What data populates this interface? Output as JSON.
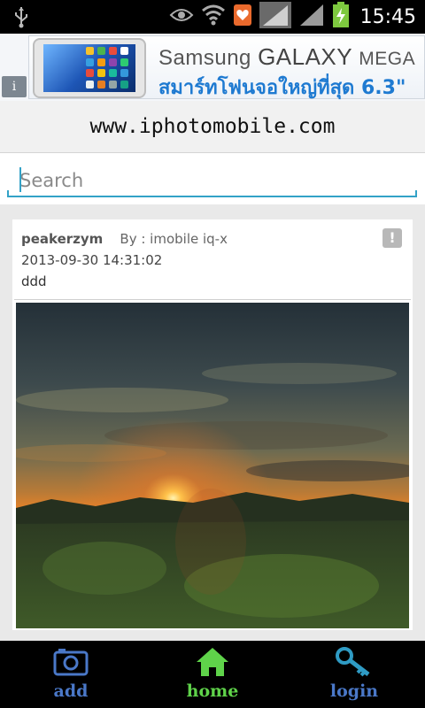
{
  "status_bar": {
    "time": "15:45",
    "icons": [
      "usb-icon",
      "eye-icon",
      "wifi-icon",
      "notification-icon",
      "signal-icon",
      "signal-icon-2",
      "battery-charging-icon"
    ]
  },
  "ad": {
    "brand": "Samsung",
    "model_big": "GALAXY",
    "model_small": "MEGA",
    "tagline": "สมาร์ทโฟนจอใหญ่ที่สุด 6.3\"",
    "info_icon": "i"
  },
  "site": {
    "url": "www.iphotomobile.com"
  },
  "search": {
    "placeholder": "Search",
    "value": ""
  },
  "post": {
    "author": "peakerzym",
    "by": "By : imobile iq-x",
    "date": "2013-09-30 14:31:02",
    "text": "ddd",
    "report_label": "!"
  },
  "bottom_nav": {
    "add": "add",
    "home": "home",
    "login": "login"
  },
  "colors": {
    "accent": "#33a2c7",
    "nav_blue": "#4a78c8",
    "nav_green": "#5fd34a"
  }
}
